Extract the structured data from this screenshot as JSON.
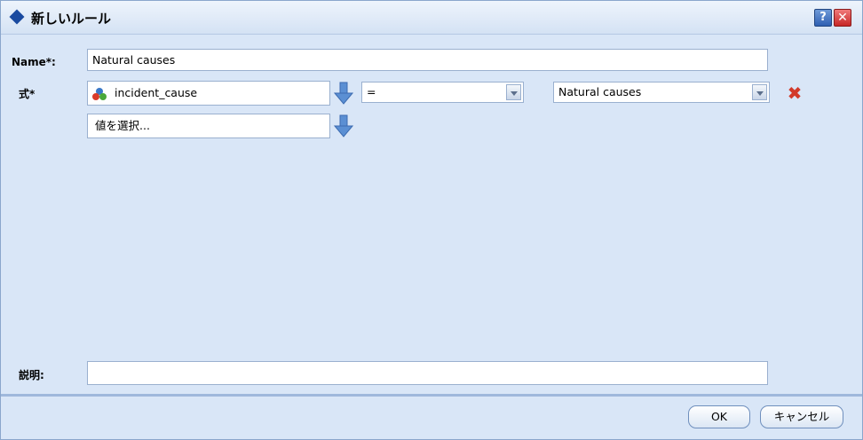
{
  "window": {
    "title": "新しいルール",
    "help_label": "?",
    "close_label": "✕"
  },
  "form": {
    "name_label": "Name*:",
    "name_value": "Natural causes",
    "expression_label": "式*",
    "field_value": "incident_cause",
    "operator_value": "=",
    "value_select": "Natural causes",
    "choose_value_placeholder": "値を選択...",
    "description_label": "説明:",
    "description_value": ""
  },
  "footer": {
    "ok_label": "OK",
    "cancel_label": "キャンセル"
  },
  "icons": {
    "title": "diamond-icon",
    "field": "field-nominal-icon",
    "drop_arrow": "arrow-down-icon",
    "delete": "delete-x-icon"
  },
  "colors": {
    "dialog_bg": "#d9e6f7",
    "accent": "#1a4aa0",
    "delete_red": "#d23a2a"
  }
}
